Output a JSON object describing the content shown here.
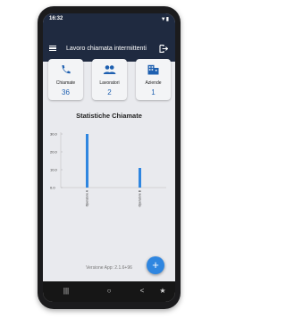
{
  "status": {
    "time": "16:32",
    "icons": "▼▮"
  },
  "appbar": {
    "title": "Lavoro chiamata intermittenti"
  },
  "cards": [
    {
      "label": "Chiamate",
      "value": "36",
      "icon": "phone-icon"
    },
    {
      "label": "Lavoratori",
      "value": "2",
      "icon": "people-icon"
    },
    {
      "label": "Aziende",
      "value": "1",
      "icon": "building-icon"
    }
  ],
  "chart_data": {
    "type": "bar",
    "title": "Statistiche Chiamate",
    "categories": [
      "Operatore A",
      "Operatore B"
    ],
    "values": [
      30,
      11
    ],
    "ylim": [
      0,
      30
    ],
    "yticks": [
      "30.0",
      "20.0",
      "10.0",
      "0.0"
    ],
    "bar_color": "#2f86e0"
  },
  "footer": {
    "version": "Versione App: 2.1.6+96"
  },
  "fab": {
    "label": "+"
  },
  "navbar": {
    "recent": "|||",
    "home": "○",
    "back": "<",
    "accessibility": "★"
  },
  "colors": {
    "primary": "#1f2a40",
    "accent": "#2f86e0",
    "value_text": "#1d5fb0"
  }
}
